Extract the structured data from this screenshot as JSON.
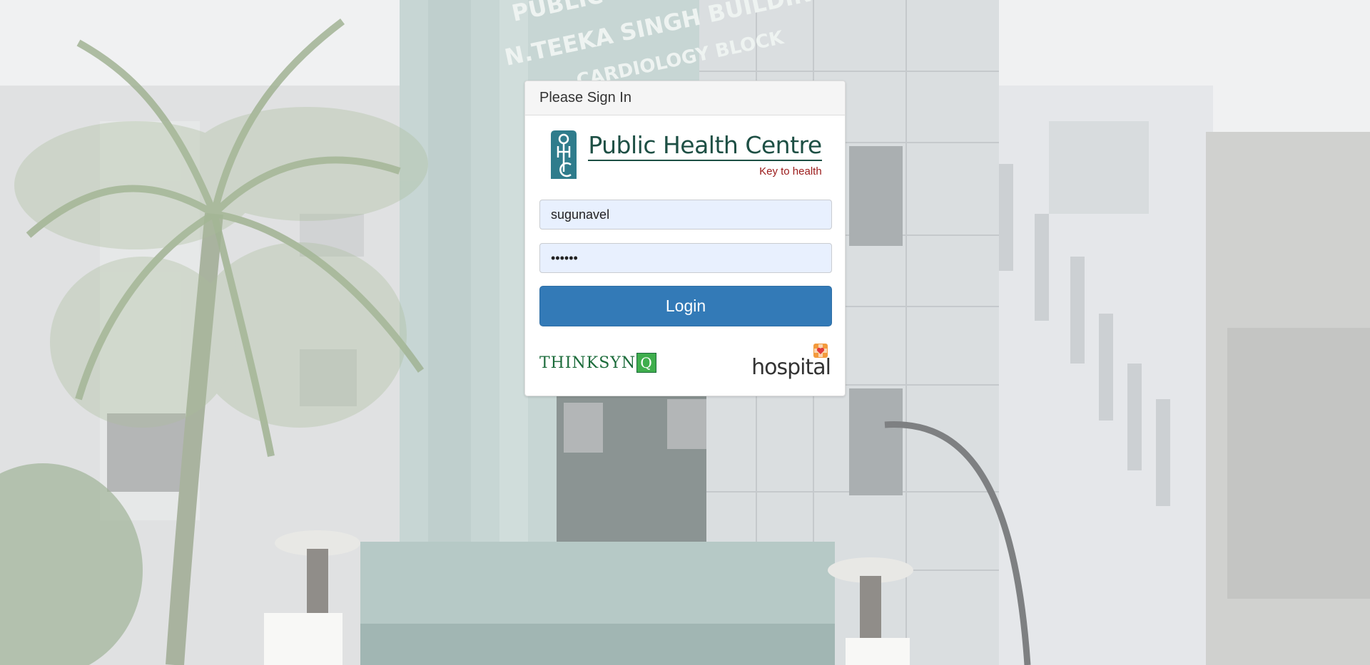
{
  "panel": {
    "heading": "Please Sign In"
  },
  "logo": {
    "title": "Public Health Centre",
    "tagline": "Key to health",
    "mark_icon": "phc-key-icon"
  },
  "form": {
    "username_value": "sugunavel",
    "password_value": "••••••",
    "login_label": "Login"
  },
  "footer": {
    "left_logo_text": "THINKSYN",
    "left_logo_q": "Q",
    "right_logo_text": "hospital",
    "right_logo_icon": "heart-cross-icon"
  },
  "background": {
    "sign_line1": "PUBLIC HEALTH",
    "sign_line2": "N.TEEKA SINGH BUILDING",
    "sign_line3": "CARDIOLOGY BLOCK"
  },
  "colors": {
    "primary": "#337ab7",
    "logo_green": "#1d4f44",
    "tagline_red": "#9b1b1b",
    "input_bg": "#e8f0fe"
  }
}
